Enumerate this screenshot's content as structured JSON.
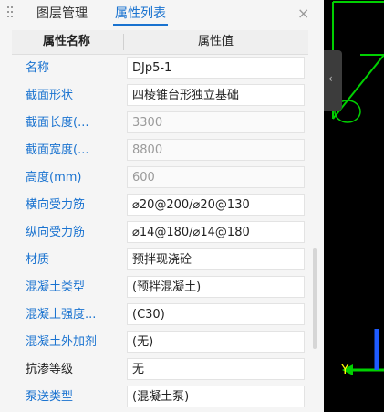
{
  "tabs": {
    "layers": "图层管理",
    "properties": "属性列表",
    "close_glyph": "×"
  },
  "table": {
    "header": {
      "name": "属性名称",
      "value": "属性值"
    },
    "rows": [
      {
        "name": "名称",
        "value": "DJp5-1",
        "name_color": "blue",
        "value_style": "normal"
      },
      {
        "name": "截面形状",
        "value": "四棱锥台形独立基础",
        "name_color": "blue",
        "value_style": "normal"
      },
      {
        "name": "截面长度(...",
        "value": "3300",
        "name_color": "blue",
        "value_style": "gray"
      },
      {
        "name": "截面宽度(...",
        "value": "8800",
        "name_color": "blue",
        "value_style": "gray"
      },
      {
        "name": "高度(mm)",
        "value": "600",
        "name_color": "blue",
        "value_style": "gray"
      },
      {
        "name": "横向受力筋",
        "value": "⌀20@200/⌀20@130",
        "name_color": "blue",
        "value_style": "normal"
      },
      {
        "name": "纵向受力筋",
        "value": "⌀14@180/⌀14@180",
        "name_color": "blue",
        "value_style": "normal"
      },
      {
        "name": "材质",
        "value": "预拌现浇砼",
        "name_color": "blue",
        "value_style": "normal"
      },
      {
        "name": "混凝土类型",
        "value": "(预拌混凝土)",
        "name_color": "blue",
        "value_style": "normal"
      },
      {
        "name": "混凝土强度...",
        "value": "(C30)",
        "name_color": "blue",
        "value_style": "normal"
      },
      {
        "name": "混凝土外加剂",
        "value": "(无)",
        "name_color": "blue",
        "value_style": "normal"
      },
      {
        "name": "抗渗等级",
        "value": "无",
        "name_color": "black",
        "value_style": "normal"
      },
      {
        "name": "泵送类型",
        "value": "(混凝土泵)",
        "name_color": "blue",
        "value_style": "normal"
      }
    ]
  },
  "viewport": {
    "axis_label": "Y",
    "collapse_glyph": "‹",
    "accent_green": "#00d000",
    "accent_blue": "#1e5bff"
  }
}
